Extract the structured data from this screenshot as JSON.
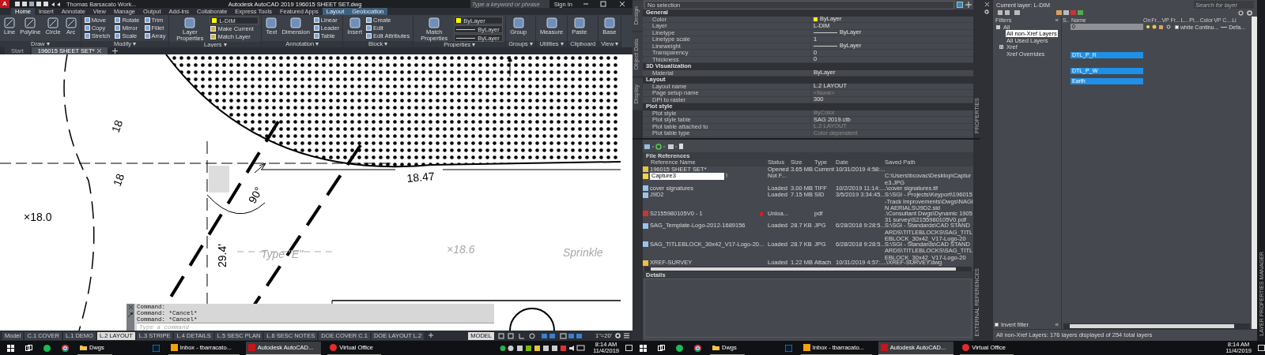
{
  "title_bar": {
    "app_letter": "A",
    "workspace": "Thomas Barsacato Work...",
    "title": "Autodesk AutoCAD 2019    196015 SHEET SET.dwg",
    "search": {
      "placeholder": "Type a keyword or phrase"
    },
    "sign_in": "Sign In"
  },
  "ribbon_tabs": [
    {
      "label": "Home",
      "selected": true,
      "contextual": false
    },
    {
      "label": "Insert",
      "selected": false,
      "contextual": false
    },
    {
      "label": "Annotate",
      "selected": false,
      "contextual": false
    },
    {
      "label": "View",
      "selected": false,
      "contextual": false
    },
    {
      "label": "Manage",
      "selected": false,
      "contextual": false
    },
    {
      "label": "Output",
      "selected": false,
      "contextual": false
    },
    {
      "label": "Add-ins",
      "selected": false,
      "contextual": false
    },
    {
      "label": "Collaborate",
      "selected": false,
      "contextual": false
    },
    {
      "label": "Express Tools",
      "selected": false,
      "contextual": false
    },
    {
      "label": "Featured Apps",
      "selected": false,
      "contextual": false
    },
    {
      "label": "Layout",
      "selected": false,
      "contextual": true
    },
    {
      "label": "Geolocation",
      "selected": false,
      "contextual": true
    }
  ],
  "panels": [
    {
      "title": "Draw ▾",
      "large": [
        "Line",
        "Polyline",
        "Circle",
        "Arc"
      ]
    },
    {
      "title": "Modify ▾",
      "small": [
        "Move",
        "Rotate",
        "Trim",
        "Copy",
        "Mirror",
        "Fillet",
        "Stretch",
        "Scale",
        "Array"
      ]
    },
    {
      "title": "Layers ▾",
      "large": [
        "Layer Properties"
      ],
      "layer": "L-DIM",
      "small": [
        "Make Current",
        "Match Layer"
      ]
    },
    {
      "title": "Annotation ▾",
      "large": [
        "Text",
        "Dimension"
      ],
      "small": [
        "Linear",
        "Leader",
        "Table"
      ]
    },
    {
      "title": "Block ▾",
      "large": [
        "Insert"
      ],
      "small": [
        "Create",
        "Edit",
        "Edit Attributes"
      ]
    },
    {
      "title": "Properties ▾",
      "large": [
        "Match Properties"
      ],
      "dropdowns": [
        "ByLayer",
        "ByLayer",
        "ByLayer"
      ]
    },
    {
      "title": "Groups ▾",
      "large": [
        "Group"
      ]
    },
    {
      "title": "Utilities ▾",
      "large": [
        "Measure"
      ]
    },
    {
      "title": "Clipboard",
      "large": [
        "Paste"
      ]
    },
    {
      "title": "View ▾",
      "large": [
        "Base"
      ]
    }
  ],
  "doc_tabs": [
    {
      "label": "Start",
      "selected": false
    },
    {
      "label": "196015 SHEET SET*",
      "selected": true
    }
  ],
  "drawing": {
    "labels": [
      "18",
      "18",
      "×18.0",
      "18.47",
      "90°",
      "29.4'",
      "×18.6",
      "Type \"E\"",
      "Sprinkle"
    ]
  },
  "command_line": {
    "history": [
      "Command:",
      "Command: *Cancel*",
      "Command: *Cancel*"
    ],
    "placeholder": "Type a command"
  },
  "layout_tabs": [
    {
      "label": "Model",
      "selected": false
    },
    {
      "label": "C.1 COVER",
      "selected": false
    },
    {
      "label": "L.1 DEMO",
      "selected": false
    },
    {
      "label": "L.2 LAYOUT",
      "selected": true
    },
    {
      "label": "L.3 STRIPE",
      "selected": false
    },
    {
      "label": "L.4 DETAILS",
      "selected": false
    },
    {
      "label": "L.5 SESC PLAN",
      "selected": false
    },
    {
      "label": "L.6 SESC NOTES",
      "selected": false
    },
    {
      "label": "DOE COVER C.1",
      "selected": false
    },
    {
      "label": "DOE LAYOUT L.2",
      "selected": false
    }
  ],
  "status_bar": {
    "space": "MODEL",
    "scale": "1\"=20'"
  },
  "properties": {
    "selection": "No selection",
    "side_tabs": [
      "Design",
      "Object Data",
      "Display"
    ],
    "side_label": "PROPERTIES",
    "sections": [
      {
        "title": "General",
        "rows": [
          {
            "name": "Color",
            "value": "ByLayer",
            "kind": "color",
            "disabled": false
          },
          {
            "name": "Layer",
            "value": "L-DIM",
            "kind": "text",
            "disabled": false
          },
          {
            "name": "Linetype",
            "value": "ByLayer",
            "kind": "line",
            "disabled": false
          },
          {
            "name": "Linetype scale",
            "value": "1",
            "kind": "text",
            "disabled": false
          },
          {
            "name": "Lineweight",
            "value": "ByLayer",
            "kind": "line",
            "disabled": false
          },
          {
            "name": "Transparency",
            "value": "0",
            "kind": "text",
            "disabled": false
          },
          {
            "name": "Thickness",
            "value": "0",
            "kind": "text",
            "disabled": false
          }
        ]
      },
      {
        "title": "3D Visualization",
        "rows": [
          {
            "name": "Material",
            "value": "ByLayer",
            "kind": "text",
            "disabled": false
          }
        ]
      },
      {
        "title": "Layout",
        "rows": [
          {
            "name": "Layout name",
            "value": "L.2 LAYOUT",
            "kind": "text",
            "disabled": false
          },
          {
            "name": "Page setup name",
            "value": "<None>",
            "kind": "text",
            "disabled": true
          },
          {
            "name": "DPI to raster",
            "value": "300",
            "kind": "text",
            "disabled": false
          }
        ]
      },
      {
        "title": "Plot style",
        "rows": [
          {
            "name": "Plot style",
            "value": "ByColor",
            "kind": "text",
            "disabled": true
          },
          {
            "name": "Plot style table",
            "value": "SAG 2019.ctb",
            "kind": "text",
            "disabled": false
          },
          {
            "name": "Plot table attached to",
            "value": "L.2 LAYOUT",
            "kind": "text",
            "disabled": true
          },
          {
            "name": "Plot table type",
            "value": "Color dependent",
            "kind": "text",
            "disabled": true
          }
        ]
      }
    ]
  },
  "xrefs": {
    "title": "File References",
    "side_label": "EXTERNAL REFERENCES",
    "columns": [
      "Reference Name",
      "Status",
      "Size",
      "Type",
      "Date",
      "Saved Path"
    ],
    "rows": [
      {
        "kind": "dwg",
        "name": "196015 SHEET SET*",
        "status": "Opened",
        "size": "3.65 MB",
        "type": "Current",
        "date": "10/31/2019 4:58:...",
        "editing": false,
        "error": false
      },
      {
        "kind": "new",
        "name": "Capture3",
        "flag": "!",
        "status": "Not F...",
        "path": "C:\\Users\\bcovac\\Desktop\\Capture3.JPG",
        "editing": true,
        "error": false
      },
      {
        "kind": "image",
        "name": "cover signatures",
        "status": "Loaded",
        "size": "3.00 MB",
        "type": "TIFF",
        "date": "10/2/2019 11:14:...",
        "path": ".\\cover signatures.tif",
        "editing": false,
        "error": false
      },
      {
        "kind": "image",
        "name": "J9D2",
        "status": "Loaded",
        "size": "7.15 MB",
        "type": "SID",
        "date": "3/5/2019 3:34:45...",
        "path": "S:\\SGI - Projects\\Keyport\\196015-Track Improvements\\Dwgs\\NAGIN AERIALS\\J9D2.sid",
        "editing": false,
        "error": false
      },
      {
        "kind": "pdf",
        "name": "S2155980105V0 - 1",
        "status": "Unloa...",
        "type": "pdf",
        "path": ".\\Consultant Dwgs\\Dynamic 190531 survey\\S2155980105V0.pdf",
        "editing": false,
        "error": true
      },
      {
        "kind": "image",
        "name": "SAG_Template-Logo-2012-1689156",
        "status": "Loaded",
        "size": "28.7 KB",
        "type": "JPG",
        "date": "6/28/2018 9:28:5...",
        "path": "S:\\SGI - Standards\\CAD STANDARDS\\TITLEBLOCKS\\SAG_TITLEBLOCK_30x42_V17-Logo-20",
        "editing": false,
        "error": false
      },
      {
        "kind": "image",
        "name": "SAG_TITLEBLOCK_30x42_V17-Logo-20...",
        "status": "Loaded",
        "size": "28.7 KB",
        "type": "JPG",
        "date": "6/28/2018 9:28:5...",
        "path": "S:\\SGI - Standards\\CAD STANDARDS\\TITLEBLOCKS\\SAG_TITLEBLOCK_30x42_V17-Logo-20",
        "editing": false,
        "error": false
      },
      {
        "kind": "dwg",
        "name": "XREF-SURVEY",
        "status": "Loaded",
        "size": "1.22 MB",
        "type": "Attach",
        "date": "10/31/2019 4:57:...",
        "path": ".\\XREF-SURVEY.dwg",
        "editing": false,
        "error": false
      }
    ],
    "details_title": "Details"
  },
  "layers": {
    "current": "Current layer: L-DIM",
    "search": {
      "placeholder": "Search for layer"
    },
    "filters_title": "Filters",
    "side_label": "LAYER PROPERTIES MANAGER",
    "filters": [
      {
        "label": "All",
        "selected": false,
        "expanded": true,
        "children": [
          {
            "label": "All non-Xref Layers",
            "selected": true
          },
          {
            "label": "All Used Layers",
            "selected": false
          },
          {
            "label": "Xref",
            "selected": false,
            "expanded": false
          },
          {
            "label": "Xref Overrides",
            "selected": false
          }
        ]
      }
    ],
    "columns": [
      "S..",
      "Name",
      "On",
      "Fr...",
      "VP Fr...",
      "L...",
      "Pl...",
      "Color",
      "VP C...",
      "Li"
    ],
    "rows": [
      {
        "name": "0",
        "selected": false,
        "color_name": "white",
        "linetype": "Continu...",
        "lineweight": "Defa..."
      },
      {
        "name": "DTL_P_R",
        "selected": true
      },
      {
        "name": "DTL_P_W",
        "selected": true
      },
      {
        "name": "Earth",
        "selected": true
      }
    ],
    "invert_filter": {
      "label": "Invert filter",
      "checked": false
    },
    "collapse": "«",
    "status": "All non-Xref Layers: 176 layers displayed of 254 total layers"
  },
  "taskbars": [
    {
      "apps": [
        {
          "kind": "windows",
          "active": false
        },
        {
          "kind": "taskview",
          "active": false
        },
        {
          "kind": "spotify",
          "active": false
        },
        {
          "kind": "chrome",
          "active": false
        },
        {
          "kind": "folder",
          "label": "Dwgs",
          "active": false
        },
        {
          "kind": "photoshop",
          "active": false
        },
        {
          "kind": "outlook",
          "label": "Inbox - tbarracato...",
          "active": false
        },
        {
          "kind": "autocad",
          "label": "Autodesk AutoCAD...",
          "active": true
        },
        {
          "kind": "office",
          "label": "Virtual Office",
          "active": false
        }
      ],
      "time": "8:14 AM",
      "date": "11/4/2019"
    },
    {
      "apps": [
        {
          "kind": "windows",
          "active": false
        },
        {
          "kind": "taskview",
          "active": false
        },
        {
          "kind": "spotify",
          "active": false
        },
        {
          "kind": "chrome",
          "active": false
        },
        {
          "kind": "folder",
          "label": "Dwgs",
          "active": false
        },
        {
          "kind": "photoshop",
          "active": false
        },
        {
          "kind": "outlook",
          "label": "Inbox - tbarracato...",
          "active": false
        },
        {
          "kind": "autocad",
          "label": "Autodesk AutoCAD...",
          "active": true
        },
        {
          "kind": "office",
          "label": "Virtual Office",
          "active": false
        }
      ],
      "time": "8:14 AM",
      "date": "11/4/2019"
    }
  ]
}
